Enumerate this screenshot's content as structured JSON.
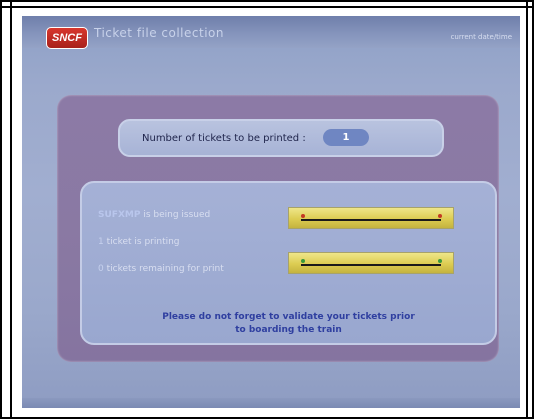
{
  "header": {
    "logo_text": "SNCF",
    "title": "Ticket file collection",
    "datetime": "current date/time"
  },
  "summary": {
    "label": "Number of tickets to be printed :",
    "count": "1"
  },
  "status": {
    "issuing_code": "SUFXMP",
    "issuing_text": "is being issued",
    "printing_count": "1",
    "printing_text": "ticket is printing",
    "remaining_count": "0",
    "remaining_text": "tickets remaining for print"
  },
  "indicators": {
    "issuing": {
      "bar_color": "#dccc52",
      "dot_color": "#c43a22",
      "label": "issuing-progress"
    },
    "remaining": {
      "bar_color": "#dccc52",
      "dot_color": "#3a9a3a",
      "label": "remaining-progress"
    }
  },
  "notice": {
    "line1": "Please do not forget to validate your tickets prior",
    "line2": "to boarding the train"
  }
}
